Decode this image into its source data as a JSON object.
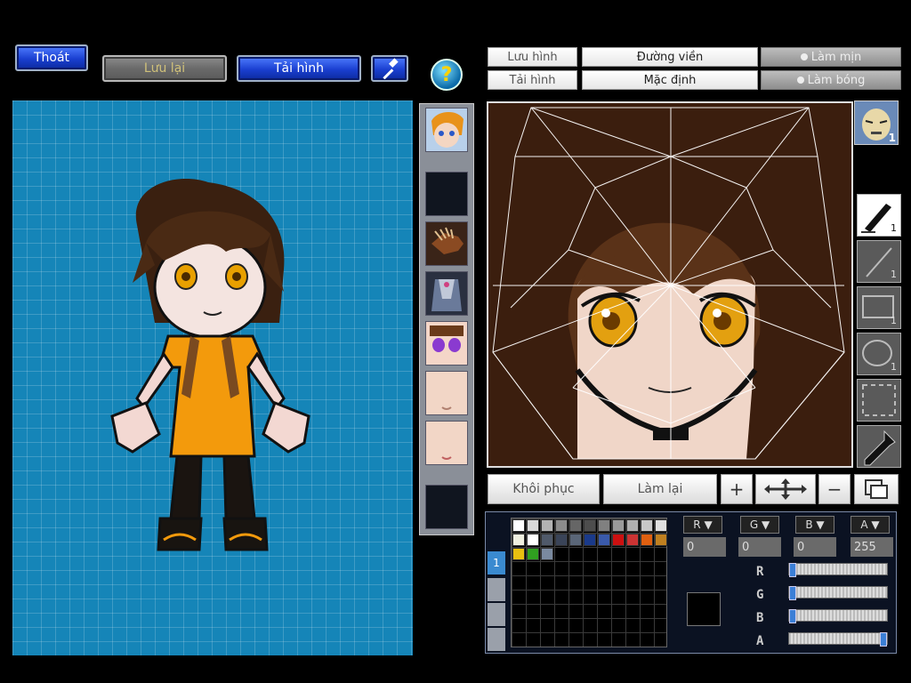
{
  "top_buttons": {
    "exit": "Thoát",
    "save": "Lưu lại",
    "load_image": "Tải hình"
  },
  "editor_tabs": {
    "save_image": "Lưu hình",
    "outline": "Đường viền",
    "smooth": "Làm mịn",
    "load_image": "Tải hình",
    "default": "Mặc định",
    "shine": "Làm bóng"
  },
  "actions": {
    "restore": "Khôi phục",
    "redo": "Làm lại",
    "plus": "+",
    "minus": "−"
  },
  "tool_counts": [
    "1",
    "1",
    "1",
    "1"
  ],
  "avatar_badge": "1",
  "channels": {
    "r": {
      "label": "R",
      "value": "0"
    },
    "g": {
      "label": "G",
      "value": "0"
    },
    "b": {
      "label": "B",
      "value": "0"
    },
    "a": {
      "label": "A",
      "value": "255"
    }
  },
  "slider_values": {
    "r": 0,
    "g": 0,
    "b": 0,
    "a": 255
  },
  "palette_side_tab": "1",
  "palette_colors": [
    [
      "#ffffff",
      "#d9d9d9",
      "#b3b3b3",
      "#8c8c8c",
      "#666666",
      "#4d4d4d",
      "#808080",
      "#9a9a9a",
      "#b0b0b0",
      "#c8c8c8",
      "#e0e0e0"
    ],
    [
      "#f0f0e0",
      "#ffffff",
      "#505a6a",
      "#3a4458",
      "#5a6678",
      "#1a3a8a",
      "#3a5aaa",
      "#cc1010",
      "#cc3333",
      "#e06010",
      "#c08020"
    ],
    [
      "#e8c010",
      "#30a020",
      "#7a8aa0"
    ]
  ],
  "icons": {
    "help": "question-icon",
    "hammer": "hammer-icon"
  }
}
